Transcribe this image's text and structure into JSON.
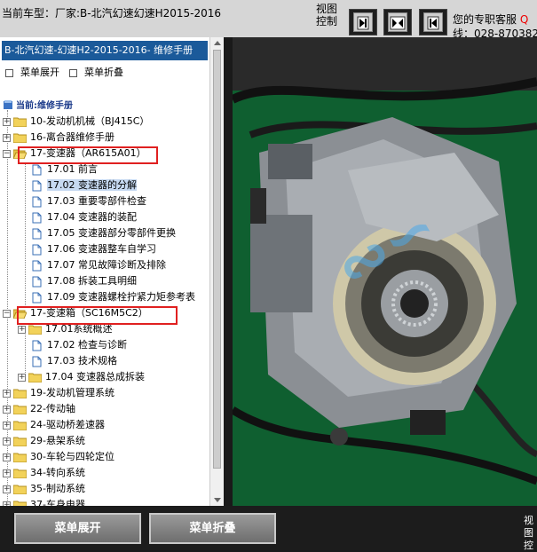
{
  "header": {
    "car_model": "当前车型：厂家:B-北汽幻速幻速H2015-2016",
    "view_control": "视图控制",
    "service_label": "您的专职客服",
    "service_q": "Q",
    "service_phone": "线：028-870382"
  },
  "panel": {
    "manual_title": "B-北汽幻速-幻速H2-2015-2016- 维修手册",
    "expand_menu": "菜单展开",
    "collapse_menu": "菜单折叠",
    "root_label": "当前:维修手册"
  },
  "tree": [
    {
      "label": "10-发动机机械（BJ415C）"
    },
    {
      "label": "16-离合器维修手册"
    },
    {
      "label": "17-变速器（AR615A01）"
    },
    {
      "label": "17.01 前言"
    },
    {
      "label": "17.02 变速器的分解"
    },
    {
      "label": "17.03 重要零部件检查"
    },
    {
      "label": "17.04 变速器的装配"
    },
    {
      "label": "17.05 变速器部分零部件更换"
    },
    {
      "label": "17.06 变速器整车自学习"
    },
    {
      "label": "17.07 常见故障诊断及排除"
    },
    {
      "label": "17.08 拆装工具明细"
    },
    {
      "label": "17.09 变速器螺栓拧紧力矩参考表"
    },
    {
      "label": "17-变速箱（SC16M5C2）"
    },
    {
      "label": "17.01系统概述"
    },
    {
      "label": "17.02 检查与诊断"
    },
    {
      "label": "17.03 技术规格"
    },
    {
      "label": "17.04 变速器总成拆装"
    },
    {
      "label": "19-发动机管理系统"
    },
    {
      "label": "22-传动轴"
    },
    {
      "label": "24-驱动桥差速器"
    },
    {
      "label": "29-悬架系统"
    },
    {
      "label": "30-车轮与四轮定位"
    },
    {
      "label": "34-转向系统"
    },
    {
      "label": "35-制动系统"
    },
    {
      "label": "37-车身电器"
    }
  ],
  "bottom": {
    "expand_button": "菜单展开",
    "collapse_button": "菜单折叠",
    "view_control": "视图控"
  },
  "colors": {
    "title_bar": "#1b5a9a",
    "highlight_box": "#e02020",
    "selected_item": "#c6d9f1",
    "watermark": "#4aa8e8"
  },
  "icons": [
    "first-page-icon",
    "fit-page-icon",
    "previous-page-icon",
    "folder-icon",
    "document-icon",
    "book-icon"
  ]
}
